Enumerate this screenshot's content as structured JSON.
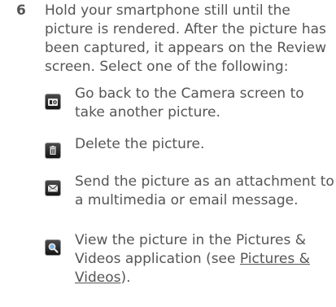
{
  "step": {
    "number": "6",
    "text": "Hold your smartphone still until the picture is rendered. After the picture has been captured, it appears on the Review screen. Select one of the following:"
  },
  "options": [
    {
      "icon": "camera-icon",
      "text": "Go back to the Camera screen to take another picture."
    },
    {
      "icon": "trash-icon",
      "text": "Delete the picture."
    },
    {
      "icon": "envelope-icon",
      "text": "Send the picture as an attachment to a multimedia or email message."
    },
    {
      "icon": "magnifier-icon",
      "text_before": "View the picture in the Pictures & Videos application (see ",
      "link": "Pictures & Videos",
      "text_after": ")."
    }
  ]
}
